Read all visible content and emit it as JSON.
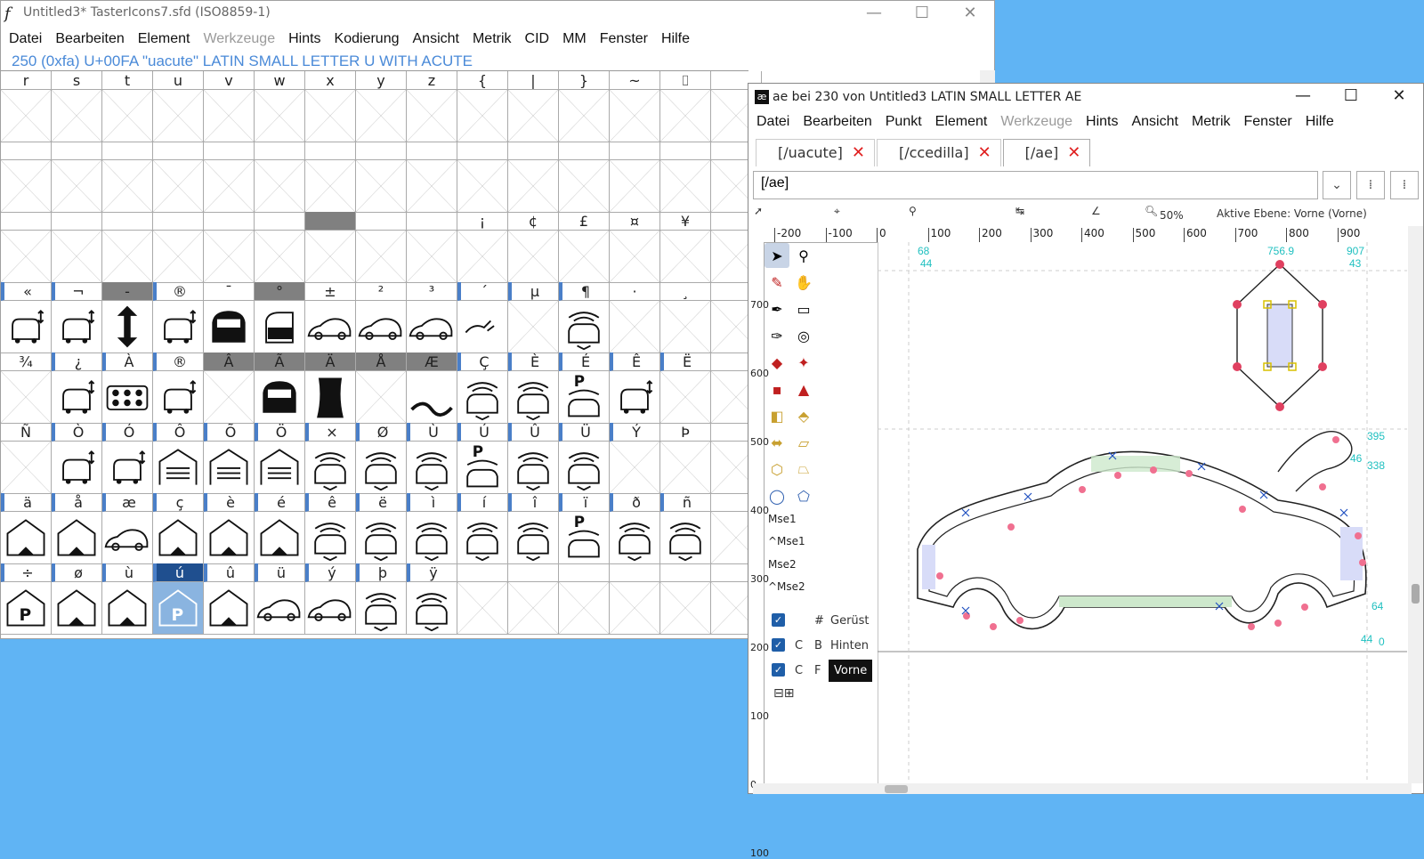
{
  "font_window": {
    "title": "Untitled3*  TasterIcons7.sfd (ISO8859-1)",
    "menu": [
      "Datei",
      "Bearbeiten",
      "Element",
      "Werkzeuge",
      "Hints",
      "Kodierung",
      "Ansicht",
      "Metrik",
      "CID",
      "MM",
      "Fenster",
      "Hilfe"
    ],
    "disabled_menu": "Werkzeuge",
    "glyph_info": "250 (0xfa) U+00FA \"uacute\" LATIN SMALL LETTER U WITH ACUTE",
    "rows": [
      {
        "labels": [
          "r",
          "s",
          "t",
          "u",
          "v",
          "w",
          "x",
          "y",
          "z",
          "{",
          "|",
          "}",
          "~",
          "⌷",
          "",
          ""
        ],
        "icons": [
          "",
          "",
          "",
          "",
          "",
          "",
          "",
          "",
          "",
          "",
          "",
          "",
          "",
          "",
          "",
          ""
        ]
      },
      {
        "labels": [
          "",
          "",
          "",
          "",
          "",
          "",
          "",
          "",
          "",
          "",
          "",
          "",
          "",
          "",
          "",
          ""
        ],
        "icons": [
          "",
          "",
          "",
          "",
          "",
          "",
          "",
          "",
          "",
          "",
          "",
          "",
          "",
          "",
          "",
          ""
        ]
      },
      {
        "labels": [
          "",
          "",
          "",
          "",
          "",
          "",
          "",
          "",
          "",
          "¡",
          "¢",
          "£",
          "¤",
          "¥",
          "",
          ""
        ],
        "icons": [
          "",
          "",
          "",
          "",
          "",
          "",
          "",
          "",
          "",
          "",
          "",
          "",
          "",
          "",
          "",
          ""
        ]
      },
      {
        "labels": [
          "«",
          "¬",
          "-",
          "®",
          "¯",
          "°",
          "±",
          "²",
          "³",
          "´",
          "µ",
          "¶",
          "·",
          "¸",
          "",
          ""
        ],
        "icons": [
          "car-lift",
          "car-lift",
          "arrow",
          "car-lift",
          "car-front",
          "car-open",
          "car-side",
          "car-side",
          "car-side",
          "plug",
          "",
          "wifi-car",
          "",
          "",
          "",
          ""
        ]
      },
      {
        "labels": [
          "¾",
          "¿",
          "À",
          "®",
          "Â",
          "Ã",
          "Ä",
          "Å",
          "Æ",
          "Ç",
          "È",
          "É",
          "Ê",
          "Ë",
          "",
          ""
        ],
        "icons": [
          "",
          "car-lift",
          "dots",
          "car-lift",
          "",
          "car-front",
          "shape",
          "",
          "zig",
          "wifi-car",
          "wifi-car",
          "p-wifi",
          "car-lift",
          "",
          "",
          ""
        ]
      },
      {
        "labels": [
          "Ñ",
          "Ò",
          "Ó",
          "Ô",
          "Õ",
          "Ö",
          "×",
          "Ø",
          "Ù",
          "Ú",
          "Û",
          "Ü",
          "Ý",
          "Þ",
          "",
          ""
        ],
        "icons": [
          "",
          "car-lift",
          "car-lift",
          "garage",
          "garage",
          "garage",
          "wifi-car",
          "wifi-car",
          "wifi-car",
          "p-wifi",
          "wifi-car",
          "wifi-car",
          "",
          "",
          "",
          ""
        ]
      },
      {
        "labels": [
          "ä",
          "å",
          "æ",
          "ç",
          "è",
          "é",
          "ê",
          "ë",
          "ì",
          "í",
          "î",
          "ï",
          "ð",
          "ñ",
          "",
          ""
        ],
        "icons": [
          "home",
          "home",
          "car-side",
          "home",
          "home",
          "home",
          "wifi-car",
          "wifi-car",
          "wifi-car",
          "wifi-car",
          "wifi-car",
          "p-wifi",
          "wifi-car",
          "wifi-car",
          "",
          ""
        ]
      },
      {
        "labels": [
          "÷",
          "ø",
          "ù",
          "ú",
          "û",
          "ü",
          "ý",
          "þ",
          "ÿ",
          "",
          "",
          "",
          "",
          "",
          "",
          ""
        ],
        "icons": [
          "parking",
          "home",
          "home",
          "parking",
          "home",
          "car-side",
          "car-side",
          "wifi-car",
          "wifi-car",
          "",
          "",
          "",
          "",
          "",
          "",
          ""
        ]
      }
    ]
  },
  "char_window": {
    "title": "ae bei 230 von Untitled3 LATIN SMALL LETTER AE",
    "menu": [
      "Datei",
      "Bearbeiten",
      "Punkt",
      "Element",
      "Werkzeuge",
      "Hints",
      "Ansicht",
      "Metrik",
      "Fenster",
      "Hilfe"
    ],
    "disabled_menu": "Werkzeuge",
    "tabs": [
      "[/uacute]",
      "[/ccedilla]",
      "[/ae]"
    ],
    "glyph_field": "[/ae]",
    "zoom": "50%",
    "active_layer": "Aktive Ebene: Vorne (Vorne)",
    "ruler": [
      "-200",
      "-100",
      "0",
      "100",
      "200",
      "300",
      "400",
      "500",
      "600",
      "700",
      "800",
      "900"
    ],
    "vruler": [
      "700",
      "600",
      "500",
      "400",
      "300",
      "200",
      "100",
      "0",
      "100"
    ],
    "mouse_labels": [
      "Mse1",
      "^Mse1",
      "Mse2",
      "^Mse2"
    ],
    "layers": [
      {
        "c1": "",
        "c2": "#",
        "name": "Gerüst"
      },
      {
        "c1": "C",
        "c2": "B",
        "name": "Hinten"
      },
      {
        "c1": "C",
        "c2": "F",
        "name": "Vorne"
      }
    ],
    "coord_labels": [
      "68",
      "44",
      "756.9",
      "907",
      "43",
      "395",
      "46",
      "338",
      "64",
      "44",
      "0"
    ],
    "layer_buttons": "⊟⊞"
  }
}
